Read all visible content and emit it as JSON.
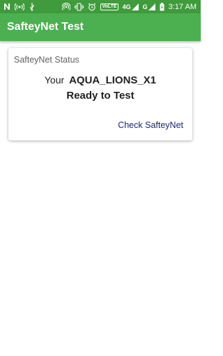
{
  "status_bar": {
    "icons_left": [
      "n-icon",
      "wifi-hotspot-icon",
      "usb-icon"
    ],
    "icons_right": [
      "hotspot-icon",
      "vibrate-icon",
      "alarm-icon",
      "vol-lte-badge",
      "signal-icon",
      "signal-icon-2",
      "battery-icon"
    ],
    "volte_label": "VoLTE",
    "network_4g": "4G",
    "network_g": "G",
    "time": "3:17 AM"
  },
  "app_bar": {
    "title": "SafteyNet Test"
  },
  "card": {
    "title": "SafteyNet Status",
    "prefix": "Your",
    "device_name": "AQUA_LIONS_X1",
    "status": "Ready to Test",
    "action_label": "Check SafteyNet"
  },
  "colors": {
    "status_bar": "#3f9b3c",
    "app_bar": "#4caf50",
    "action_text": "#1a237e"
  }
}
